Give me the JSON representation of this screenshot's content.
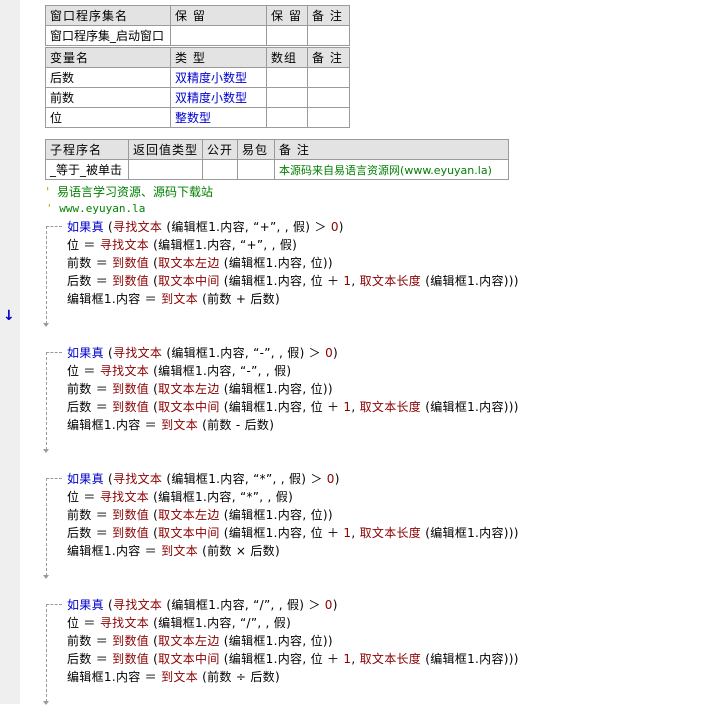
{
  "table1": {
    "h": [
      "窗口程序集名",
      "保 留",
      "保 留",
      "备 注"
    ],
    "r": [
      "窗口程序集_启动窗口",
      "",
      "",
      ""
    ]
  },
  "table2": {
    "h": [
      "变量名",
      "类 型",
      "数组",
      "备 注"
    ],
    "rows": [
      {
        "name": "后数",
        "type": "双精度小数型"
      },
      {
        "name": "前数",
        "type": "双精度小数型"
      },
      {
        "name": "位",
        "type": "整数型"
      }
    ]
  },
  "table3": {
    "h": [
      "子程序名",
      "返回值类型",
      "公开",
      "易包",
      "备 注"
    ],
    "r": {
      "name": "_等于_被单击",
      "note": "本源码来自易语言资源网(www.eyuyan.la)"
    }
  },
  "comments": {
    "c1": "易语言学习资源、源码下载站",
    "c2": "www.eyuyan.la"
  },
  "code": {
    "if": "如果真",
    "find": "寻找文本",
    "edit": "编辑框1.内容",
    "false": "假",
    "zero": "0",
    "pos": "位",
    "front": "前数",
    "back": "后数",
    "toval": "到数值",
    "left": "取文本左边",
    "mid": "取文本中间",
    "len": "取文本长度",
    "one": "1",
    "totext": "到文本",
    "ops": [
      "+",
      "-",
      "*",
      "/"
    ],
    "calc": [
      "+",
      "-",
      "×",
      "÷"
    ]
  }
}
